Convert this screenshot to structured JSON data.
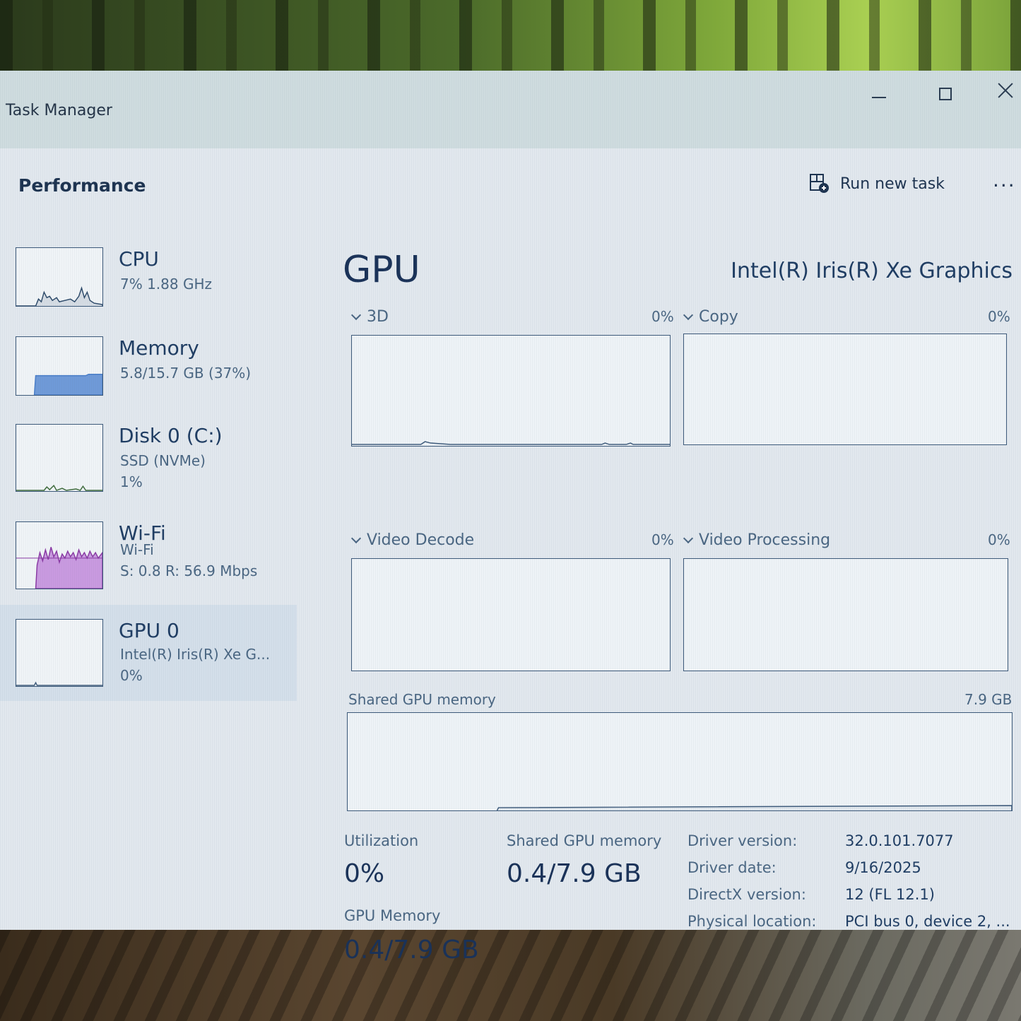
{
  "window": {
    "title": "Task Manager"
  },
  "header": {
    "heading": "Performance",
    "run_new_task_label": "Run new task",
    "more_label": "..."
  },
  "sidebar": {
    "items": [
      {
        "name": "CPU",
        "line1": "7% 1.88 GHz",
        "line2": "",
        "color": "#3d5a7a"
      },
      {
        "name": "Memory",
        "line1": "5.8/15.7 GB (37%)",
        "line2": "",
        "color": "#4a7ec8"
      },
      {
        "name": "Disk 0 (C:)",
        "line1": "SSD (NVMe)",
        "line2": "1%",
        "color": "#3d6a3a"
      },
      {
        "name": "Wi-Fi",
        "line1": "Wi-Fi",
        "line2": "S: 0.8 R: 56.9 Mbps",
        "color": "#a04ab4"
      },
      {
        "name": "GPU 0",
        "line1": "Intel(R) Iris(R) Xe G...",
        "line2": "0%",
        "color": "#3d5a7a"
      }
    ]
  },
  "main": {
    "title": "GPU",
    "model": "Intel(R) Iris(R) Xe Graphics",
    "graphs": [
      {
        "label": "3D",
        "percent": "0%"
      },
      {
        "label": "Copy",
        "percent": "0%"
      },
      {
        "label": "Video Decode",
        "percent": "0%"
      },
      {
        "label": "Video Processing",
        "percent": "0%"
      }
    ],
    "shared_memory_graph": {
      "label": "Shared GPU memory",
      "max": "7.9 GB"
    },
    "stats": {
      "utilization_label": "Utilization",
      "utilization_value": "0%",
      "shared_label": "Shared GPU memory",
      "shared_value": "0.4/7.9 GB",
      "gpu_memory_label": "GPU Memory",
      "gpu_memory_value": "0.4/7.9 GB"
    },
    "info": [
      {
        "key": "Driver version:",
        "value": "32.0.101.7077"
      },
      {
        "key": "Driver date:",
        "value": "9/16/2025"
      },
      {
        "key": "DirectX version:",
        "value": "12 (FL 12.1)"
      },
      {
        "key": "Physical location:",
        "value": "PCI bus 0, device 2, ..."
      }
    ]
  },
  "colors": {
    "accent": "#1a3258",
    "graph_border": "#3d5a7a",
    "memory_fill": "#4a7ec8",
    "wifi_fill": "#b07ad0"
  }
}
